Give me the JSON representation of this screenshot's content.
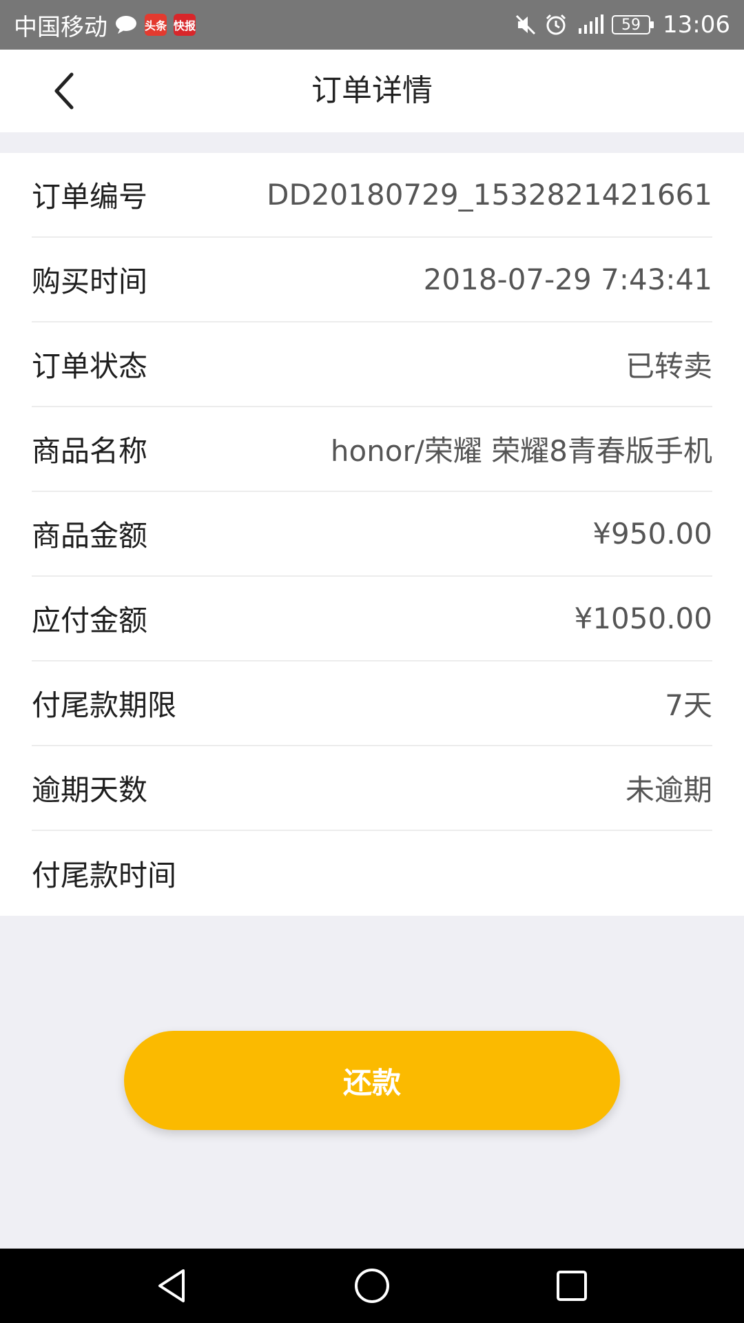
{
  "status_bar": {
    "carrier": "中国移动",
    "app_badge_1": "头条",
    "app_badge_2": "快报",
    "battery": "59",
    "time": "13:06",
    "icons": [
      "chat-bubble-icon",
      "mute-icon",
      "alarm-icon",
      "signal-4g-icon",
      "battery-icon"
    ]
  },
  "header": {
    "title": "订单详情",
    "back_icon": "chevron-left-icon"
  },
  "details": [
    {
      "label": "订单编号",
      "value": "DD20180729_1532821421661"
    },
    {
      "label": "购买时间",
      "value": "2018-07-29 7:43:41"
    },
    {
      "label": "订单状态",
      "value": "已转卖"
    },
    {
      "label": "商品名称",
      "value": "honor/荣耀 荣耀8青春版手机"
    },
    {
      "label": "商品金额",
      "value": "¥950.00"
    },
    {
      "label": "应付金额",
      "value": "¥1050.00"
    },
    {
      "label": "付尾款期限",
      "value": "7天"
    },
    {
      "label": "逾期天数",
      "value": "未逾期"
    },
    {
      "label": "付尾款时间",
      "value": ""
    }
  ],
  "actions": {
    "pay_label": "还款"
  },
  "colors": {
    "accent": "#fbba00",
    "background": "#efeff4",
    "status_bar": "#777777"
  },
  "nav_bar": {
    "icons": [
      "back-triangle-icon",
      "home-circle-icon",
      "recents-square-icon"
    ]
  }
}
